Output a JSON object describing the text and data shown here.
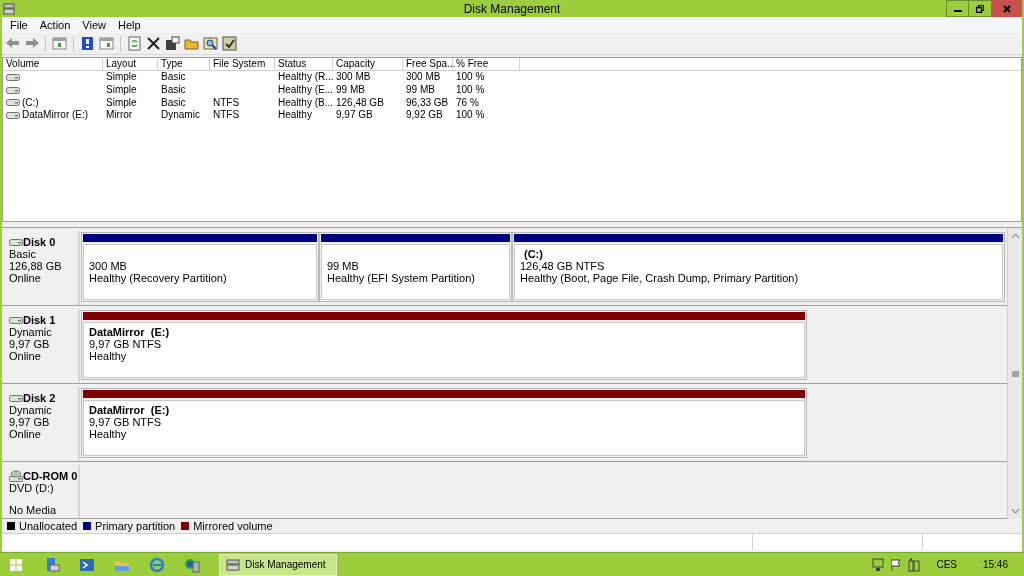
{
  "window": {
    "title": "Disk Management"
  },
  "menu": [
    "File",
    "Action",
    "View",
    "Help"
  ],
  "volume_table": {
    "columns": [
      "Volume",
      "Layout",
      "Type",
      "File System",
      "Status",
      "Capacity",
      "Free Spa...",
      "% Free"
    ],
    "rows": [
      {
        "cells": [
          "",
          "Simple",
          "Basic",
          "",
          "Healthy (R...",
          "300 MB",
          "300 MB",
          "100 %"
        ]
      },
      {
        "cells": [
          "",
          "Simple",
          "Basic",
          "",
          "Healthy (E...",
          "99 MB",
          "99 MB",
          "100 %"
        ]
      },
      {
        "cells": [
          "(C:)",
          "Simple",
          "Basic",
          "NTFS",
          "Healthy (B...",
          "126,48 GB",
          "96,33 GB",
          "76 %"
        ]
      },
      {
        "cells": [
          "DataMirror (E:)",
          "Mirror",
          "Dynamic",
          "NTFS",
          "Healthy",
          "9,97 GB",
          "9,92 GB",
          "100 %"
        ]
      }
    ]
  },
  "disks": [
    {
      "kind": "disk",
      "name": "Disk 0",
      "type": "Basic",
      "size": "126,88 GB",
      "state": "Online",
      "partitions": [
        {
          "kind": "primary",
          "size": "300 MB",
          "status": "Healthy (Recovery Partition)"
        },
        {
          "kind": "primary",
          "size": "99 MB",
          "status": "Healthy (EFI System Partition)"
        },
        {
          "kind": "primary",
          "name": "(C:)",
          "size": "126,48 GB NTFS",
          "status": "Healthy (Boot, Page File, Crash Dump, Primary Partition)"
        }
      ]
    },
    {
      "kind": "disk",
      "name": "Disk 1",
      "type": "Dynamic",
      "size": "9,97 GB",
      "state": "Online",
      "partitions": [
        {
          "kind": "mirrored",
          "name": "DataMirror  (E:)",
          "size": "9,97 GB NTFS",
          "status": "Healthy"
        }
      ]
    },
    {
      "kind": "disk",
      "name": "Disk 2",
      "type": "Dynamic",
      "size": "9,97 GB",
      "state": "Online",
      "partitions": [
        {
          "kind": "mirrored",
          "name": "DataMirror  (E:)",
          "size": "9,97 GB NTFS",
          "status": "Healthy"
        }
      ]
    },
    {
      "kind": "cdrom",
      "name": "CD-ROM 0",
      "type": "DVD (D:)",
      "state": "No Media"
    }
  ],
  "legend": [
    {
      "label": "Unallocated",
      "color": "#000000"
    },
    {
      "label": "Primary partition",
      "color": "#000080"
    },
    {
      "label": "Mirrored volume",
      "color": "#800000"
    }
  ],
  "taskbar": {
    "tasks": [
      {
        "label": "Disk Management",
        "selected": true
      }
    ],
    "language": "CES",
    "time": "15:46"
  }
}
